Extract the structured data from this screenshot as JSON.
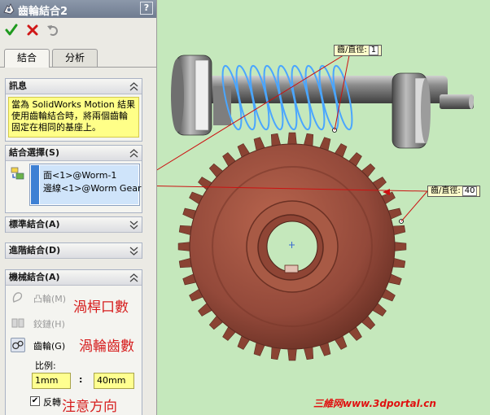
{
  "window": {
    "title": "齒輪結合2",
    "help_label": "?"
  },
  "toolbar": {
    "ok_icon": "checkmark-icon",
    "cancel_icon": "x-icon",
    "undo_icon": "undo-icon"
  },
  "tabs": [
    {
      "label": "結合",
      "active": true
    },
    {
      "label": "分析",
      "active": false
    }
  ],
  "groups": {
    "info": {
      "title": "訊息",
      "message": "當為 SolidWorks Motion 結果使用齒輪結合時，將兩個齒輪固定在相同的基座上。"
    },
    "selections": {
      "title": "結合選擇(S)",
      "items": [
        "面<1>@Worm-1",
        "邊線<1>@Worm Gear"
      ]
    },
    "standard": {
      "title": "標準結合(A)"
    },
    "advanced": {
      "title": "進階結合(D)"
    },
    "mechanical": {
      "title": "機械結合(A)",
      "options": [
        {
          "label": "凸輪(M)",
          "icon": "cam-icon",
          "enabled": false
        },
        {
          "label": "鉸鏈(H)",
          "icon": "hinge-icon",
          "enabled": false
        },
        {
          "label": "齒輪(G)",
          "icon": "gear-icon",
          "enabled": true,
          "selected": true
        }
      ],
      "ratio_label": "比例:",
      "ratio_a": "1mm",
      "ratio_sep": ":",
      "ratio_b": "40mm",
      "reverse_label": "反轉",
      "reverse_checked": true
    }
  },
  "annotations": {
    "worm_count": "渦桿口數",
    "gear_count": "渦輪齒數",
    "direction": "注意方向"
  },
  "viewport": {
    "tag_worm": {
      "label": "齒/直徑:",
      "value": "1"
    },
    "tag_gear": {
      "label": "齒/直徑:",
      "value": "40"
    },
    "watermark": "三維网www.3dportal.cn"
  },
  "colors": {
    "viewport_bg": "#c5e8bc",
    "gear_body": "#a0513f",
    "worm_highlight": "#4aa6ff",
    "annotation": "#d61e1e",
    "info_bg": "#ffff88"
  }
}
